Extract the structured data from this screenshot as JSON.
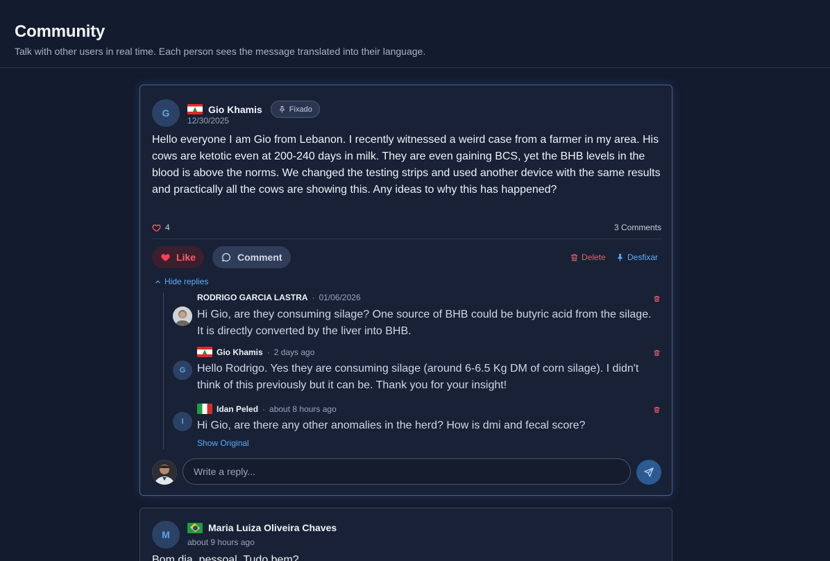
{
  "page": {
    "title": "Community",
    "subtitle": "Talk with other users in real time. Each person sees the message translated into their language."
  },
  "pinned_post": {
    "avatar_initial": "G",
    "author": "Gio Khamis",
    "pin_badge": "Fixado",
    "date": "12/30/2025",
    "body": "Hello everyone I am Gio from Lebanon. I recently witnessed a weird case from a farmer in my area. His cows are ketotic even at 200-240 days in milk. They are even gaining BCS, yet the BHB levels in the blood is above the norms. We changed the testing strips and used another device with the same results and practically all the cows are showing this. Any ideas to why this has happened?",
    "likes": "4",
    "comments_count": "3 Comments",
    "like_label": "Like",
    "comment_label": "Comment",
    "delete_label": "Delete",
    "unpin_label": "Desfixar",
    "hide_replies_label": "Hide replies",
    "replies": [
      {
        "author": "RODRIGO GARCIA LASTRA",
        "time": "01/06/2026",
        "text": "Hi Gio, are they consuming silage? One source of BHB could be butyric acid from the silage. It is directly converted by the liver into BHB."
      },
      {
        "author": "Gio Khamis",
        "avatar_initial": "G",
        "time": "2 days ago",
        "text": "Hello Rodrigo. Yes they are consuming silage (around 6-6.5 Kg DM of corn silage). I didn't think of this previously but it can be. Thank you for your insight!"
      },
      {
        "author": "Idan Peled",
        "avatar_initial": "I",
        "time": "about 8 hours ago",
        "text": "Hi Gio, are there any other anomalies in the herd? How is dmi and fecal score?",
        "show_original": "Show Original"
      }
    ],
    "reply_placeholder": "Write a reply..."
  },
  "second_post": {
    "avatar_initial": "M",
    "author": "Maria Luiza Oliveira Chaves",
    "time": "about 9 hours ago",
    "body": "Bom dia, pessoal. Tudo bem?"
  },
  "colors": {
    "background": "#131b2e",
    "card": "#182135",
    "accent": "#5aaeff",
    "danger": "#ef5b6b"
  }
}
